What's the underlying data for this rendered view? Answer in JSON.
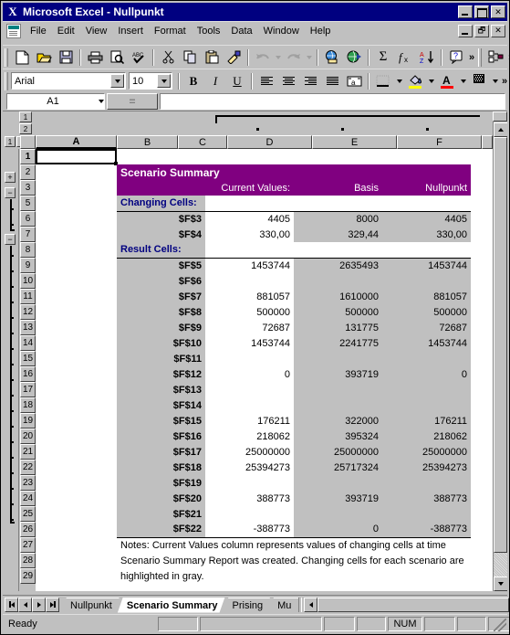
{
  "window": {
    "title": "Microsoft Excel - Nullpunkt",
    "app_icon": "excel-x-icon",
    "minimize": "_",
    "maximize": "□",
    "close": "✕"
  },
  "menu": {
    "items": [
      {
        "label": "File"
      },
      {
        "label": "Edit"
      },
      {
        "label": "View"
      },
      {
        "label": "Insert"
      },
      {
        "label": "Format"
      },
      {
        "label": "Tools"
      },
      {
        "label": "Data"
      },
      {
        "label": "Window"
      },
      {
        "label": "Help"
      }
    ],
    "doc_restore": "_",
    "doc_maximize": "□",
    "doc_close": "✕"
  },
  "standard_toolbar": {
    "buttons": [
      {
        "name": "new-icon"
      },
      {
        "name": "open-icon"
      },
      {
        "name": "save-icon"
      },
      {
        "name": "print-icon"
      },
      {
        "name": "print-preview-icon"
      },
      {
        "name": "spelling-icon"
      },
      {
        "name": "cut-icon"
      },
      {
        "name": "copy-icon"
      },
      {
        "name": "paste-icon"
      },
      {
        "name": "format-painter-icon"
      },
      {
        "name": "undo-icon"
      },
      {
        "name": "redo-icon"
      },
      {
        "name": "insert-hyperlink-icon"
      },
      {
        "name": "web-toolbar-icon"
      },
      {
        "name": "autosum-icon",
        "glyph": "Σ"
      },
      {
        "name": "paste-function-icon",
        "glyph": "ƒ"
      },
      {
        "name": "sort-ascending-icon"
      },
      {
        "name": "help-icon",
        "glyph": "?"
      },
      {
        "name": "more-buttons-icon",
        "glyph": "»"
      }
    ]
  },
  "formatting_toolbar": {
    "font_name": "Arial",
    "font_size": "10",
    "bold": "B",
    "italic": "I",
    "underline": "U",
    "more_buttons": "»",
    "buttons": [
      {
        "name": "align-left-icon"
      },
      {
        "name": "align-center-icon"
      },
      {
        "name": "align-right-icon"
      },
      {
        "name": "justify-icon"
      },
      {
        "name": "merge-and-center-icon"
      },
      {
        "name": "borders-icon"
      },
      {
        "name": "fill-color-icon",
        "color": "#ffff00"
      },
      {
        "name": "font-color-icon",
        "color": "#ff0000"
      },
      {
        "name": "pattern-icon"
      }
    ]
  },
  "formula_bar": {
    "name_box": "A1",
    "equals_button": "=",
    "formula_value": ""
  },
  "sheet": {
    "outline_levels_col": [
      "1",
      "2"
    ],
    "outline_levels_row": [
      "1",
      "2"
    ],
    "columns": [
      {
        "label": "A",
        "selected": true,
        "width": 89
      },
      {
        "label": "B",
        "selected": false,
        "width": 67
      },
      {
        "label": "C",
        "selected": false,
        "width": 54
      },
      {
        "label": "D",
        "selected": false,
        "width": 93
      },
      {
        "label": "E",
        "selected": false,
        "width": 93
      },
      {
        "label": "F",
        "selected": false,
        "width": 93
      }
    ],
    "rows": [
      "1",
      "2",
      "3",
      "5",
      "6",
      "7",
      "8",
      "9",
      "10",
      "11",
      "12",
      "13",
      "14",
      "15",
      "16",
      "17",
      "18",
      "19",
      "20",
      "21",
      "22",
      "23",
      "24",
      "25",
      "26",
      "27",
      "28",
      "29"
    ],
    "outline_expand_button": "+",
    "outline_collapse_button": "−"
  },
  "report": {
    "title": "Scenario Summary",
    "column_headers": [
      "",
      "Current Values:",
      "Basis",
      "Nullpunkt"
    ],
    "sections": [
      {
        "heading": "Changing Cells:",
        "rows": [
          {
            "cell": "$F$3",
            "current": "4405",
            "basis": "8000",
            "nullpunkt": "4405"
          },
          {
            "cell": "$F$4",
            "current": "330,00",
            "basis": "329,44",
            "nullpunkt": "330,00"
          }
        ]
      },
      {
        "heading": "Result Cells:",
        "rows": [
          {
            "cell": "$F$5",
            "current": "1453744",
            "basis": "2635493",
            "nullpunkt": "1453744"
          },
          {
            "cell": "$F$6",
            "current": "",
            "basis": "",
            "nullpunkt": ""
          },
          {
            "cell": "$F$7",
            "current": "881057",
            "basis": "1610000",
            "nullpunkt": "881057"
          },
          {
            "cell": "$F$8",
            "current": "500000",
            "basis": "500000",
            "nullpunkt": "500000"
          },
          {
            "cell": "$F$9",
            "current": "72687",
            "basis": "131775",
            "nullpunkt": "72687"
          },
          {
            "cell": "$F$10",
            "current": "1453744",
            "basis": "2241775",
            "nullpunkt": "1453744"
          },
          {
            "cell": "$F$11",
            "current": "",
            "basis": "",
            "nullpunkt": ""
          },
          {
            "cell": "$F$12",
            "current": "0",
            "basis": "393719",
            "nullpunkt": "0"
          },
          {
            "cell": "$F$13",
            "current": "",
            "basis": "",
            "nullpunkt": ""
          },
          {
            "cell": "$F$14",
            "current": "",
            "basis": "",
            "nullpunkt": ""
          },
          {
            "cell": "$F$15",
            "current": "176211",
            "basis": "322000",
            "nullpunkt": "176211"
          },
          {
            "cell": "$F$16",
            "current": "218062",
            "basis": "395324",
            "nullpunkt": "218062"
          },
          {
            "cell": "$F$17",
            "current": "25000000",
            "basis": "25000000",
            "nullpunkt": "25000000"
          },
          {
            "cell": "$F$18",
            "current": "25394273",
            "basis": "25717324",
            "nullpunkt": "25394273"
          },
          {
            "cell": "$F$19",
            "current": "",
            "basis": "",
            "nullpunkt": ""
          },
          {
            "cell": "$F$20",
            "current": "388773",
            "basis": "393719",
            "nullpunkt": "388773"
          },
          {
            "cell": "$F$21",
            "current": "",
            "basis": "",
            "nullpunkt": ""
          },
          {
            "cell": "$F$22",
            "current": "-388773",
            "basis": "0",
            "nullpunkt": "-388773"
          }
        ]
      }
    ],
    "notes": "Notes:  Current Values column represents values of changing cells at time Scenario Summary Report was created.  Changing cells for each scenario are highlighted in gray.",
    "colors": {
      "title_background": "#800080",
      "title_text": "#ffffff",
      "section_heading_text": "#000080",
      "changing_cell_highlight": "#c0c0c0"
    }
  },
  "tab_bar": {
    "nav_first": "|◀",
    "nav_prev": "◀",
    "nav_next": "▶",
    "nav_last": "▶|",
    "tabs": [
      {
        "label": "Nullpunkt",
        "active": false
      },
      {
        "label": "Scenario Summary",
        "active": true
      },
      {
        "label": "Prising",
        "active": false
      },
      {
        "label": "Mu",
        "active": false
      }
    ]
  },
  "status_bar": {
    "message": "Ready",
    "num_lock": "NUM"
  }
}
